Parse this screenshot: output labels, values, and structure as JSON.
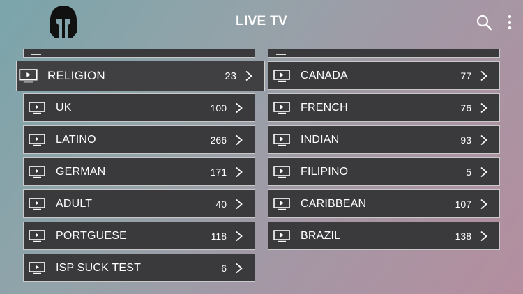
{
  "header": {
    "title": "LIVE TV",
    "logo_icon": "spartan-helmet-icon",
    "search_icon": "search-icon",
    "more_icon": "more-vertical-icon"
  },
  "colors": {
    "tile_bg": "#3a3a3c",
    "tile_border": "#c9c9c9",
    "text": "#ffffff"
  },
  "left_column": [
    {
      "label": "RELIGION",
      "count": "23",
      "focused": true
    },
    {
      "label": "UK",
      "count": "100"
    },
    {
      "label": "LATINO",
      "count": "266"
    },
    {
      "label": "GERMAN",
      "count": "171"
    },
    {
      "label": "ADULT",
      "count": "40"
    },
    {
      "label": "PORTGUESE",
      "count": "118"
    },
    {
      "label": "ISP SUCK TEST",
      "count": "6"
    }
  ],
  "right_column": [
    {
      "label": "CANADA",
      "count": "77"
    },
    {
      "label": "FRENCH",
      "count": "76"
    },
    {
      "label": "INDIAN",
      "count": "93"
    },
    {
      "label": "FILIPINO",
      "count": "5"
    },
    {
      "label": "CARIBBEAN",
      "count": "107"
    },
    {
      "label": "BRAZIL",
      "count": "138"
    }
  ]
}
